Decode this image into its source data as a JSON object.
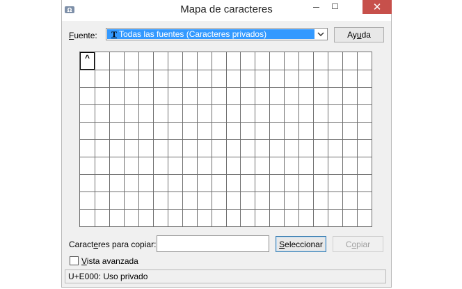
{
  "window": {
    "title": "Mapa de caracteres",
    "close_glyph": "✕"
  },
  "font": {
    "label_accel": "F",
    "label_rest": "uente:",
    "selected_icon": "T",
    "selected_value": "Todas las fuentes (Caracteres privados)"
  },
  "buttons": {
    "help_pre": "Ay",
    "help_accel": "u",
    "help_post": "da",
    "select_accel": "S",
    "select_rest": "eleccionar",
    "copy_pre": "C",
    "copy_accel": "o",
    "copy_post": "piar"
  },
  "grid": {
    "columns": 20,
    "rows": 10,
    "first_glyph": "^"
  },
  "copy_field": {
    "label_pre": "Caract",
    "label_accel": "e",
    "label_post": "res para copiar:",
    "value": ""
  },
  "advanced": {
    "label_accel": "V",
    "label_rest": "ista avanzada",
    "checked": false
  },
  "status": {
    "text": "U+E000: Uso privado"
  },
  "icons": {
    "app": "character-map-icon",
    "minimize": "minimize-icon",
    "maximize": "maximize-icon",
    "close": "close-icon",
    "dropdown": "chevron-down-icon",
    "font_type": "truetype-font-icon"
  }
}
